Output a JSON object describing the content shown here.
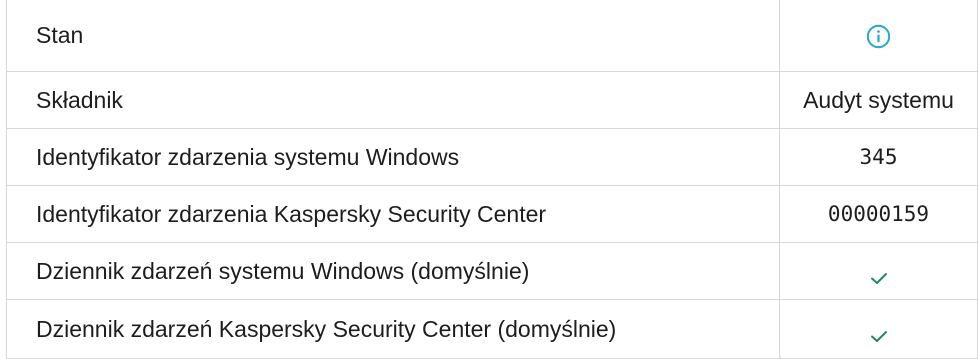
{
  "rows": [
    {
      "label": "Stan",
      "value": "",
      "value_icon": "info-icon"
    },
    {
      "label": "Składnik",
      "value": "Audyt systemu"
    },
    {
      "label": "Identyfikator zdarzenia systemu Windows",
      "value": "345"
    },
    {
      "label": "Identyfikator zdarzenia Kaspersky Security Center",
      "value": "00000159"
    },
    {
      "label": "Dziennik zdarzeń systemu Windows (domyślnie)",
      "value": "",
      "value_icon": "checkmark-icon"
    },
    {
      "label": "Dziennik zdarzeń Kaspersky Security Center (domyślnie)",
      "value": "",
      "value_icon": "checkmark-icon"
    }
  ],
  "colors": {
    "info_icon": "#29a7d8",
    "checkmark": "#1f8a5c",
    "border": "#d7d7d7",
    "text": "#1d1d1b"
  }
}
